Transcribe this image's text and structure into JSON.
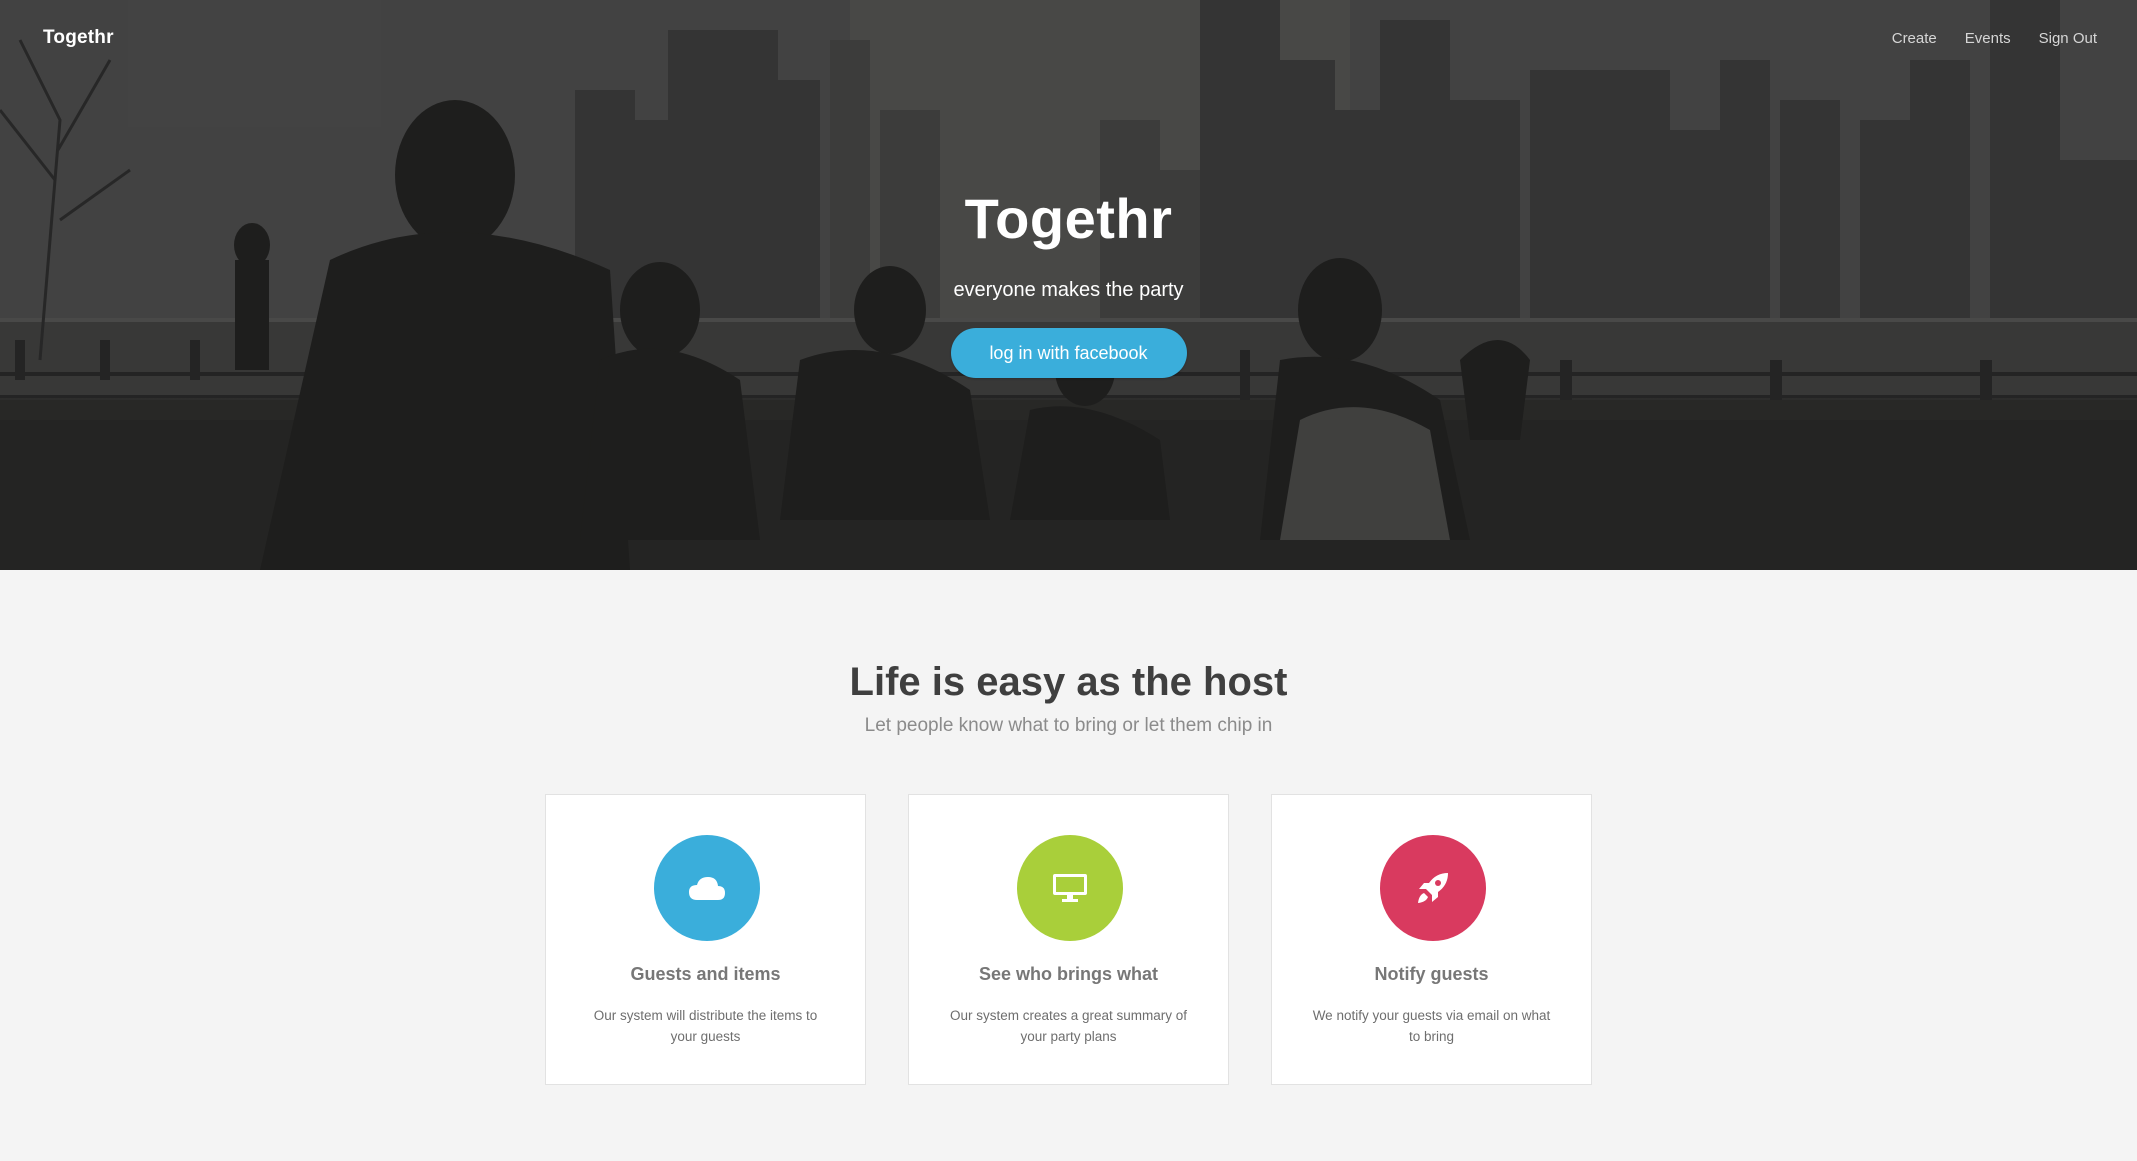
{
  "nav": {
    "brand": "Togethr",
    "links": [
      "Create",
      "Events",
      "Sign Out"
    ]
  },
  "hero": {
    "title": "Togethr",
    "subtitle": "everyone makes the party",
    "cta_label": "log in with facebook",
    "cta_color": "#3aaedb"
  },
  "features": {
    "title": "Life is easy as the host",
    "subtitle": "Let people know what to bring or let them chip in",
    "cards": [
      {
        "icon": "cloud-icon",
        "color": "#3aaedb",
        "title": "Guests and items",
        "text": "Our system will distribute the items to your guests"
      },
      {
        "icon": "monitor-icon",
        "color": "#a9cf3a",
        "title": "See who brings what",
        "text": "Our system creates a great summary of your party plans"
      },
      {
        "icon": "rocket-icon",
        "color": "#d93a5f",
        "title": "Notify guests",
        "text": "We notify your guests via email on what to bring"
      }
    ]
  }
}
